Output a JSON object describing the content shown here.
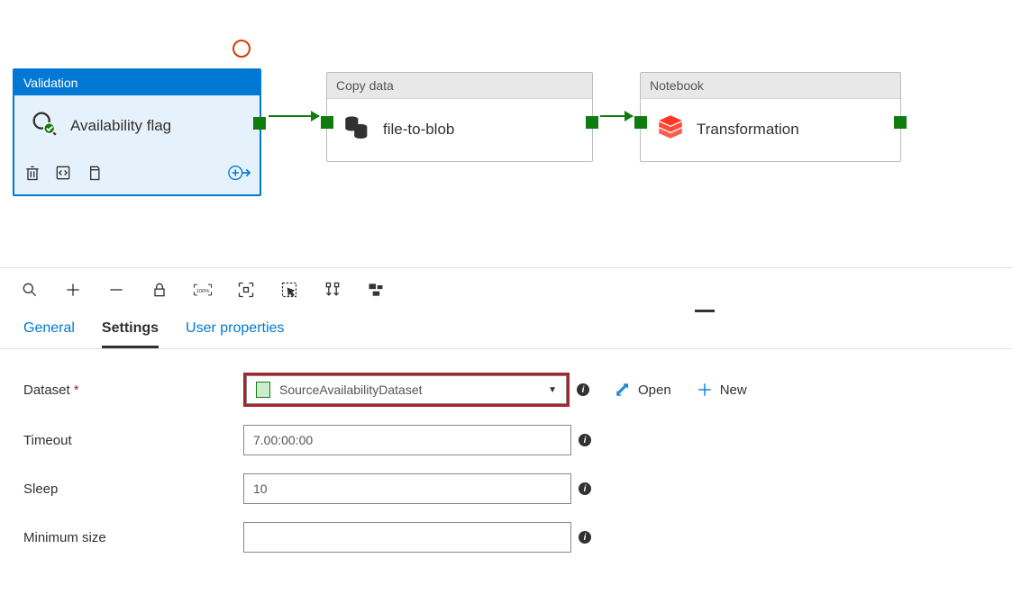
{
  "activities": {
    "validation": {
      "type": "Validation",
      "name": "Availability flag"
    },
    "copy": {
      "type": "Copy data",
      "name": "file-to-blob"
    },
    "notebook": {
      "type": "Notebook",
      "name": "Transformation"
    }
  },
  "tabs": {
    "general": "General",
    "settings": "Settings",
    "user_properties": "User properties"
  },
  "form": {
    "dataset_label": "Dataset",
    "dataset_value": "SourceAvailabilityDataset",
    "timeout_label": "Timeout",
    "timeout_value": "7.00:00:00",
    "sleep_label": "Sleep",
    "sleep_value": "10",
    "minsize_label": "Minimum size",
    "minsize_value": "",
    "open_label": "Open",
    "new_label": "New"
  }
}
